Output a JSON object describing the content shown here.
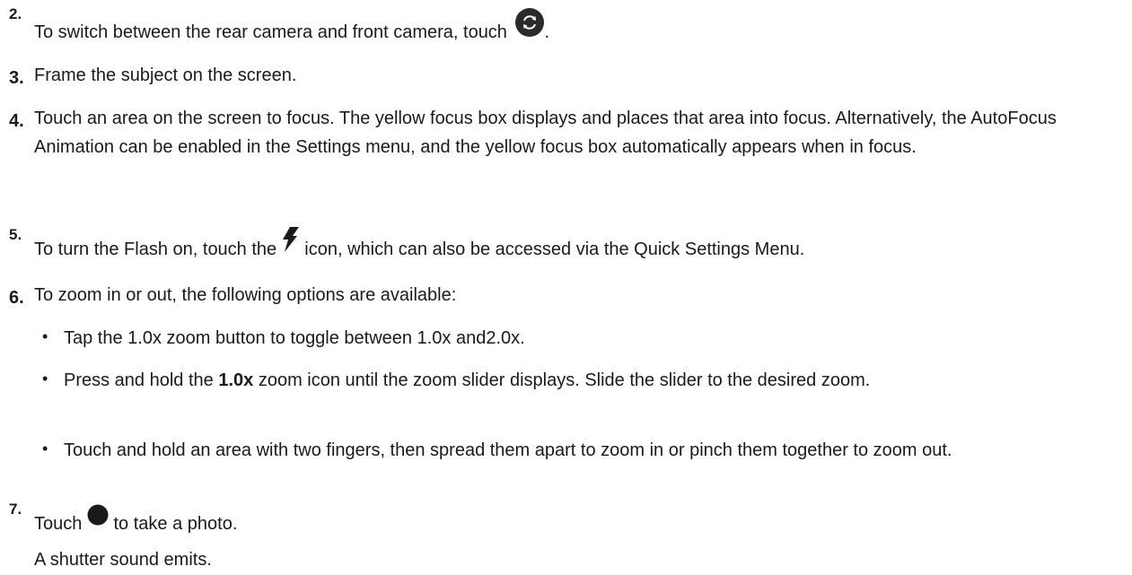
{
  "steps": [
    {
      "number": "2.",
      "text_before": "To switch between the rear camera and front camera, touch",
      "icon": "camera-switch-icon",
      "text_after": "."
    },
    {
      "number": "3.",
      "text": "Frame the subject on the screen."
    },
    {
      "number": "4.",
      "text": "Touch an area on the screen to focus. The yellow focus box displays and places that area into focus. Alternatively, the AutoFocus Animation can be enabled in the Settings menu, and the yellow focus box automatically appears when in focus."
    },
    {
      "number": "5.",
      "text_before": "To turn the Flash on, touch the",
      "icon": "flash-icon",
      "text_after": "icon, which can also be accessed via the Quick Settings Menu."
    },
    {
      "number": "6.",
      "text": "To zoom in or out, the following options are available:"
    },
    {
      "number": "7.",
      "text_before": "Touch",
      "icon": "shutter-icon",
      "text_after": "to take a photo."
    }
  ],
  "zoom_options": [
    {
      "text": "Tap the 1.0x zoom button to toggle between 1.0x and2.0x."
    },
    {
      "text_before": "Press and hold the ",
      "bold": "1.0x",
      "text_after": " zoom icon until the zoom slider displays. Slide the slider to the desired zoom."
    },
    {
      "text": "Touch and hold an area with two fingers, then spread them apart to zoom in or pinch them together to zoom out."
    }
  ],
  "bullet_char": "•",
  "result": "A shutter sound emits."
}
